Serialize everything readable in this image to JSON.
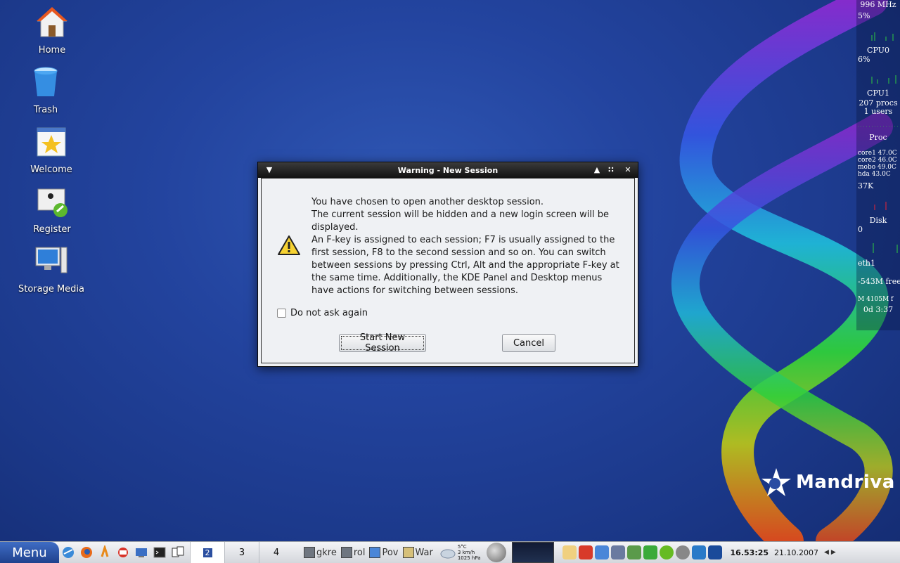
{
  "desktop": {
    "icons": [
      {
        "label": "Home"
      },
      {
        "label": "Trash"
      },
      {
        "label": "Welcome"
      },
      {
        "label": "Register"
      },
      {
        "label": "Storage Media"
      }
    ],
    "brand": "Mandriva"
  },
  "sysmon": {
    "freq": "996 MHz",
    "cpu0_pct": "5%",
    "cpu0_label": "CPU0",
    "cpu1_pct": "6%",
    "cpu1_label": "CPU1",
    "procs": "207 procs",
    "users": "1 users",
    "proc_label": "Proc",
    "temps": [
      "core1 47.0C",
      "core2 46.0C",
      "mobo 49.0C",
      "hda 43.0C"
    ],
    "net_value": "37K",
    "disk_label": "Disk",
    "disk_value": "0",
    "eth_label": "eth1",
    "mem_free": "-543M free",
    "swap": "M 4105M f",
    "uptime": "0d  3:37"
  },
  "dialog": {
    "title": "Warning - New Session",
    "message": [
      "You have chosen to open another desktop session.",
      "The current session will be hidden and a new login screen will be displayed.",
      "An F-key is assigned to each session; F7 is usually assigned to the first session, F8 to the second session and so on. You can switch between sessions by pressing Ctrl, Alt and the appropriate F-key at the same time. Additionally, the KDE Panel and Desktop menus have actions for switching between sessions."
    ],
    "checkbox_label": "Do not ask again",
    "checkbox_checked": false,
    "start_label": "Start New Session",
    "cancel_label": "Cancel"
  },
  "taskbar": {
    "menu_label": "Menu",
    "pager": [
      "2",
      "3",
      "4"
    ],
    "active_desktop": "2",
    "tasks": [
      "gkre",
      "rol",
      "Pov",
      "War"
    ],
    "weather": {
      "temp": "5°C",
      "wind": "3 km/h",
      "pressure": "1025 hPa"
    },
    "time": "16.53:25",
    "date": "21.10.2007"
  }
}
